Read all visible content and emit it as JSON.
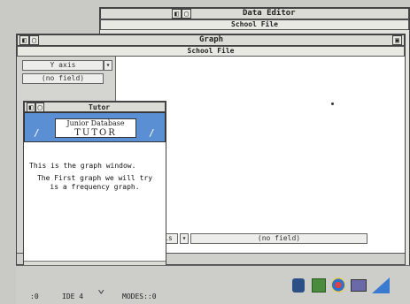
{
  "data_editor": {
    "title": "Data Editor",
    "subtitle": "School File"
  },
  "graph": {
    "title": "Graph",
    "subtitle": "School File",
    "y_axis_label": "Y axis",
    "y_axis_field": "(no field)",
    "x_axis_field": "(no field)",
    "x_axis_partial": "is"
  },
  "tutor": {
    "title": "Tutor",
    "banner_line1": "Junior Database",
    "banner_line2": "TUTOR",
    "para1": "This is the graph window.",
    "para2": "The First graph we will try is a frequency graph."
  },
  "taskbar": {
    "drive_label": "IDE 4",
    "left_label": ":0",
    "mode_label": "MODES::0"
  }
}
